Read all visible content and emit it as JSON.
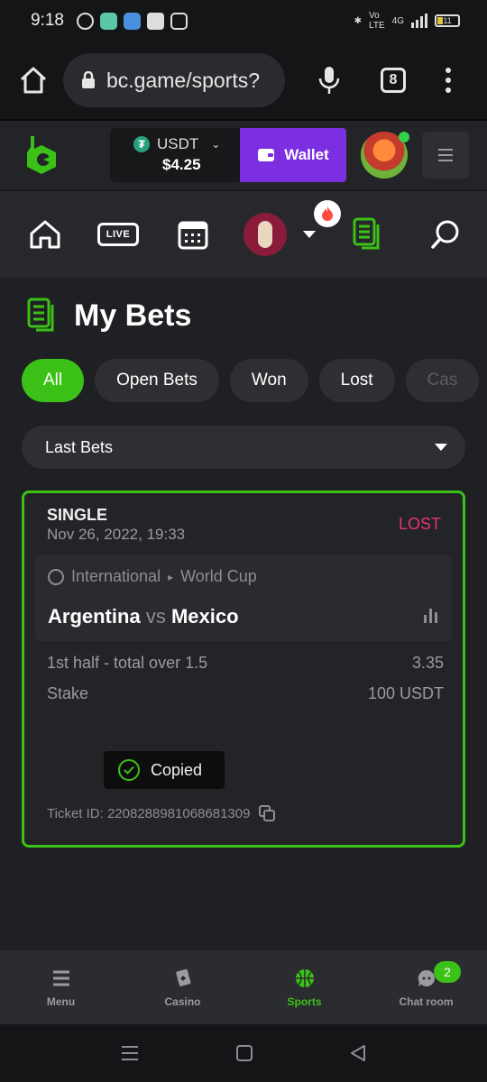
{
  "status_bar": {
    "time": "9:18",
    "network": "4G",
    "battery": "11"
  },
  "browser": {
    "url": "bc.game/sports?",
    "tab_count": "8"
  },
  "header": {
    "currency": "USDT",
    "balance": "$4.25",
    "wallet_label": "Wallet"
  },
  "sports_nav": {
    "live_label": "LIVE"
  },
  "page": {
    "title": "My Bets",
    "filters": [
      "All",
      "Open Bets",
      "Won",
      "Lost",
      "Cas"
    ],
    "active_filter": "All",
    "select_value": "Last Bets"
  },
  "bet": {
    "type": "SINGLE",
    "date": "Nov 26, 2022, 19:33",
    "status": "LOST",
    "league": "International",
    "competition": "World Cup",
    "home": "Argentina",
    "vs": "vs",
    "away": "Mexico",
    "market": "1st half - total over 1.5",
    "odds": "3.35",
    "stake_label": "Stake",
    "stake_value": "100 USDT",
    "toast": "Copied",
    "ticket": "Ticket ID: 2208288981068681309"
  },
  "tabbar": {
    "items": [
      {
        "label": "Menu"
      },
      {
        "label": "Casino"
      },
      {
        "label": "Sports"
      },
      {
        "label": "Chat room"
      }
    ],
    "chat_badge": "2",
    "active": "Sports"
  },
  "colors": {
    "accent": "#3bc117",
    "wallet": "#7b2fe0",
    "lost": "#e8337a"
  }
}
